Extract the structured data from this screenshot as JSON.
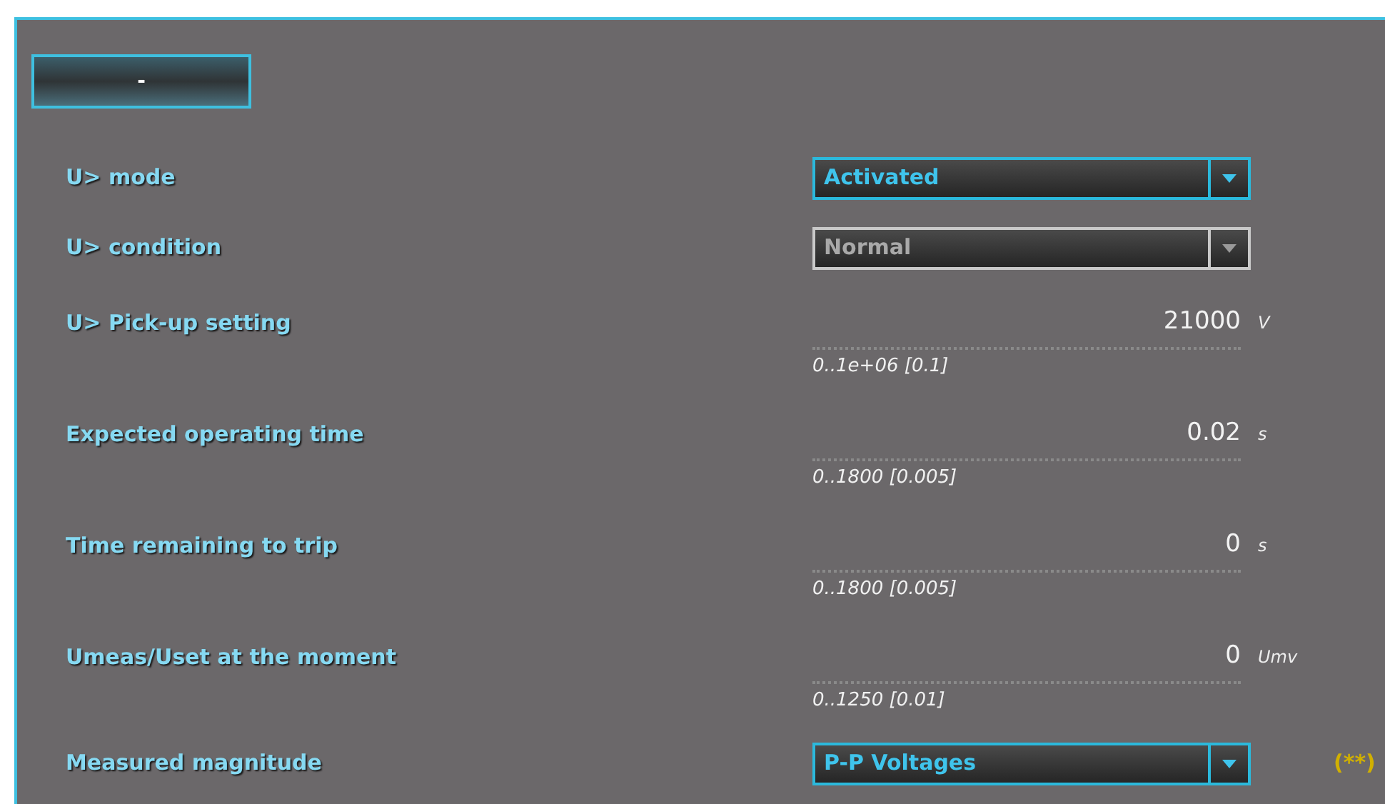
{
  "toggle_button": {
    "label": "-"
  },
  "rows": [
    {
      "kind": "select",
      "label": "U> mode",
      "value": "Activated",
      "disabled": false
    },
    {
      "kind": "select",
      "label": "U> condition",
      "value": "Normal",
      "disabled": true
    },
    {
      "kind": "number",
      "label": "U> Pick-up setting",
      "value": "21000",
      "unit": "V",
      "range": "0..1e+06 [0.1]"
    },
    {
      "kind": "number",
      "label": "Expected operating time",
      "value": "0.02",
      "unit": "s",
      "range": "0..1800 [0.005]"
    },
    {
      "kind": "number",
      "label": "Time remaining to trip",
      "value": "0",
      "unit": "s",
      "range": "0..1800 [0.005]"
    },
    {
      "kind": "number",
      "label": "Umeas/Uset at the moment",
      "value": "0",
      "unit": "Umv",
      "range": "0..1250 [0.01]"
    },
    {
      "kind": "select",
      "label": "Measured magnitude",
      "value": "P-P Voltages",
      "disabled": false,
      "note": "(**)"
    }
  ]
}
